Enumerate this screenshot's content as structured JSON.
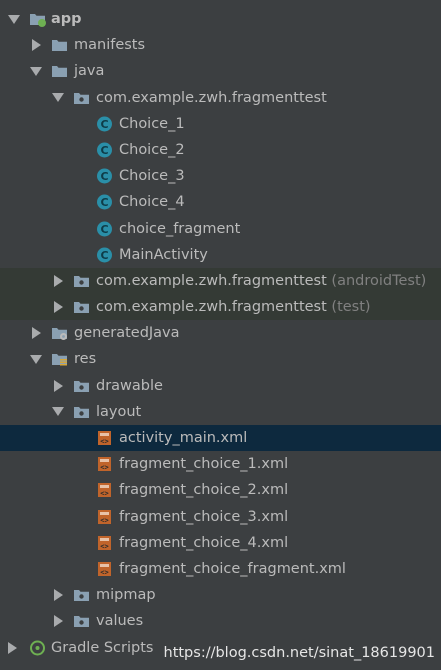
{
  "tree": {
    "app": "app",
    "manifests": "manifests",
    "java": "java",
    "pkg_main": "com.example.zwh.fragmenttest",
    "classes": [
      "Choice_1",
      "Choice_2",
      "Choice_3",
      "Choice_4",
      "choice_fragment",
      "MainActivity"
    ],
    "pkg_android_test": "com.example.zwh.fragmenttest",
    "pkg_android_test_suffix": "(androidTest)",
    "pkg_test": "com.example.zwh.fragmenttest",
    "pkg_test_suffix": "(test)",
    "generated_java": "generatedJava",
    "res": "res",
    "drawable": "drawable",
    "layout": "layout",
    "layout_files": [
      "activity_main.xml",
      "fragment_choice_1.xml",
      "fragment_choice_2.xml",
      "fragment_choice_3.xml",
      "fragment_choice_4.xml",
      "fragment_choice_fragment.xml"
    ],
    "mipmap": "mipmap",
    "values": "values",
    "gradle_scripts": "Gradle Scripts"
  },
  "watermark": "https://blog.csdn.net/sinat_18619901",
  "colors": {
    "background": "#3c3f41",
    "text": "#bbbbbb",
    "selection": "#0d293e",
    "test_highlight": "#343a35",
    "class_icon": "#2a8fa8",
    "folder_icon": "#8aa0b2",
    "xml_icon": "#c0642b"
  }
}
